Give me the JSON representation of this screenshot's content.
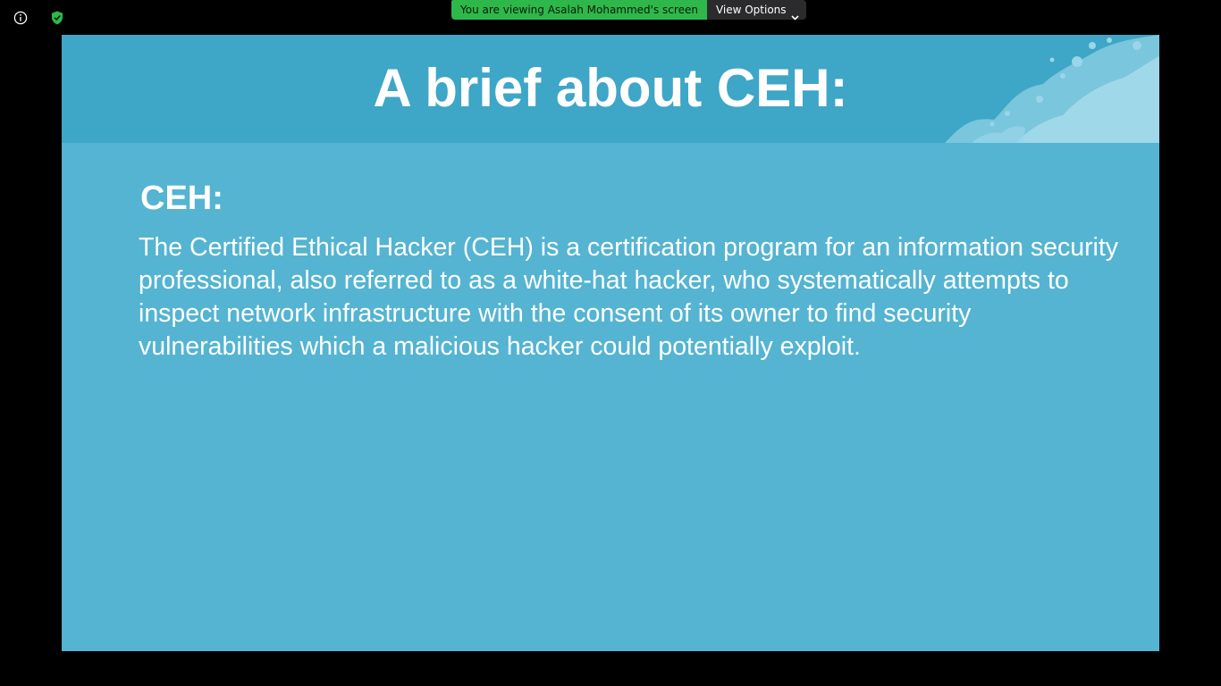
{
  "toolbar": {
    "info_icon": "info-circle-icon",
    "security_icon": "shield-check-icon",
    "security_color": "#2eb84a"
  },
  "share_banner": {
    "status_text": "You are viewing Asalah Mohammed's screen",
    "status_color": "#2eb84a",
    "view_options_label": "View Options",
    "view_options_icon": "chevron-down-icon"
  },
  "slide": {
    "title": "A brief about CEH:",
    "subtitle": "CEH:",
    "body": "The Certified Ethical Hacker (CEH) is a certification program for an information security professional, also referred to as a white-hat hacker, who systematically attempts to inspect network infrastructure with the consent of its owner to find security vulnerabilities which a malicious hacker could potentially exploit.",
    "colors": {
      "background": "#54b4d1",
      "header": "#3ea6c6",
      "text": "#ffffff"
    }
  }
}
